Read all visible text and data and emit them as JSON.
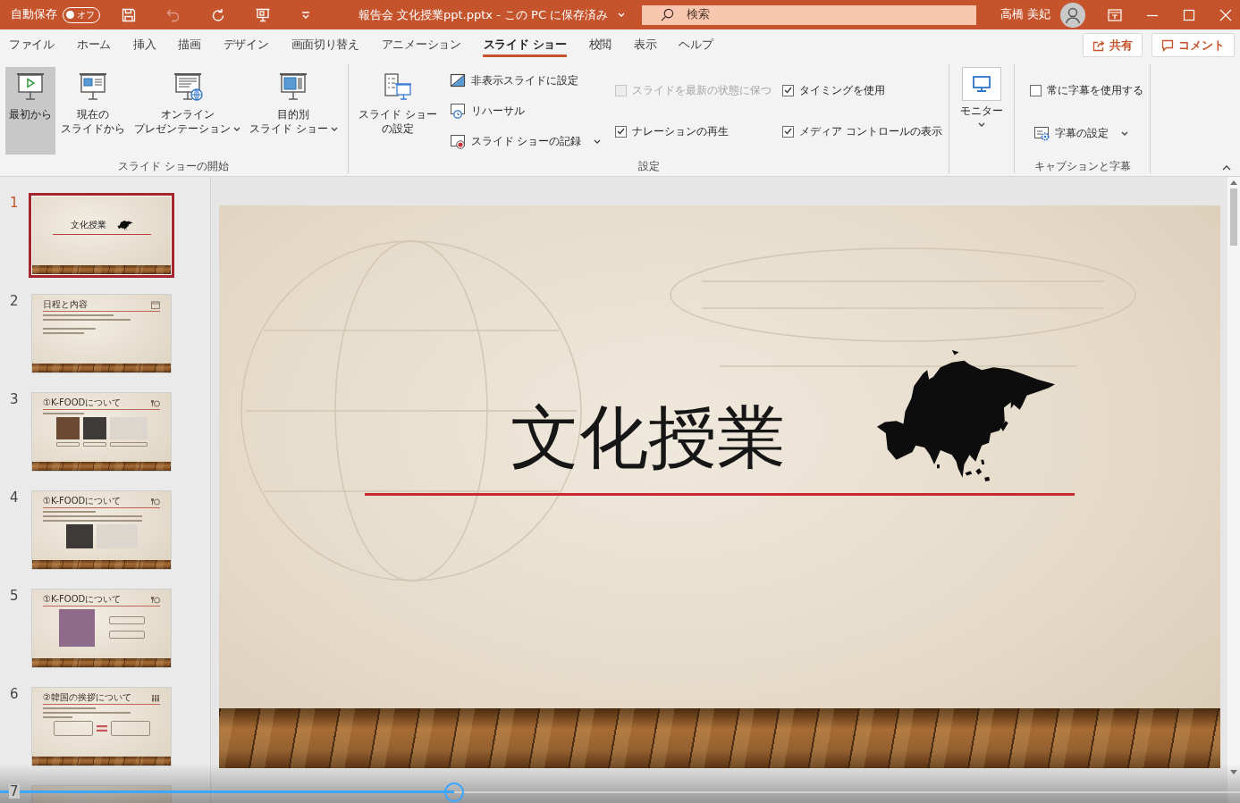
{
  "title_bar": {
    "autosave_label": "自動保存",
    "autosave_toggle": {
      "label": "オフ",
      "on": false
    },
    "quick_access": [
      {
        "kind": "save",
        "disabled": false
      },
      {
        "kind": "undo",
        "disabled": true
      },
      {
        "kind": "redo",
        "disabled": false
      },
      {
        "kind": "present",
        "disabled": false
      },
      {
        "kind": "customize",
        "disabled": false
      }
    ],
    "document_title": "報告会 文化授業ppt.pptx - この PC に保存済み",
    "search": {
      "placeholder": "検索"
    },
    "user_name": "高橋 美妃"
  },
  "ribbon_tabs": [
    {
      "label": "ファイル",
      "selected": false
    },
    {
      "label": "ホーム",
      "selected": false
    },
    {
      "label": "挿入",
      "selected": false
    },
    {
      "label": "描画",
      "selected": false
    },
    {
      "label": "デザイン",
      "selected": false
    },
    {
      "label": "画面切り替え",
      "selected": false
    },
    {
      "label": "アニメーション",
      "selected": false
    },
    {
      "label": "スライド ショー",
      "selected": true
    },
    {
      "label": "校閲",
      "selected": false
    },
    {
      "label": "表示",
      "selected": false
    },
    {
      "label": "ヘルプ",
      "selected": false
    }
  ],
  "share_button": {
    "label": "共有"
  },
  "comment_button": {
    "label": "コメント"
  },
  "ribbon": {
    "groups": [
      {
        "label": "スライド ショーの開始",
        "columns": [
          [
            {
              "kind": "large_button",
              "lines": [
                "最初から"
              ],
              "pressed": true,
              "dropdown": false
            }
          ],
          [
            {
              "kind": "large_button",
              "lines": [
                "現在の",
                "スライドから"
              ],
              "pressed": false,
              "dropdown": false
            }
          ],
          [
            {
              "kind": "large_button",
              "lines": [
                "オンライン",
                "プレゼンテーション"
              ],
              "pressed": false,
              "dropdown": true
            }
          ],
          [
            {
              "kind": "large_button",
              "lines": [
                "目的別",
                "スライド ショー"
              ],
              "pressed": false,
              "dropdown": true
            }
          ]
        ]
      },
      {
        "label": "設定",
        "columns": [
          [
            {
              "kind": "large_button",
              "lines": [
                "スライド ショー",
                "の設定"
              ],
              "pressed": false,
              "dropdown": false
            }
          ],
          [
            {
              "kind": "small_button",
              "lines": [
                "非表示スライドに設定"
              ],
              "pressed": false,
              "dropdown": false
            },
            {
              "kind": "small_button",
              "lines": [
                "リハーサル"
              ],
              "pressed": false,
              "dropdown": false
            },
            {
              "kind": "small_button",
              "lines": [
                "スライド ショーの記録"
              ],
              "pressed": false,
              "dropdown": true
            }
          ],
          [
            {
              "kind": "checkbox",
              "label": "スライドを最新の状態に保つ",
              "checked": false,
              "disabled": true
            },
            {
              "kind": "checkbox",
              "label": "ナレーションの再生",
              "checked": true,
              "disabled": false
            }
          ],
          [
            {
              "kind": "checkbox",
              "label": "タイミングを使用",
              "checked": true,
              "disabled": false
            },
            {
              "kind": "checkbox",
              "label": "メディア コントロールの表示",
              "checked": true,
              "disabled": false
            }
          ]
        ]
      },
      {
        "columns": [
          [
            {
              "kind": "boxed_button",
              "lines": [
                "モニター"
              ],
              "pressed": false,
              "dropdown": true
            }
          ]
        ]
      },
      {
        "label": "キャプションと字幕",
        "columns": [
          [
            {
              "kind": "checkbox",
              "label": "常に字幕を使用する",
              "checked": false,
              "disabled": false
            },
            {
              "kind": "small_button",
              "lines": [
                "字幕の設定"
              ],
              "pressed": false,
              "dropdown": true
            }
          ]
        ]
      }
    ]
  },
  "slides": [
    {
      "number": "1",
      "selected": true,
      "kind": "title",
      "title": "文化授業"
    },
    {
      "number": "2",
      "selected": false,
      "kind": "agenda",
      "title": "日程と内容"
    },
    {
      "number": "3",
      "selected": false,
      "kind": "three_photos",
      "title": "①K-FOODについて"
    },
    {
      "number": "4",
      "selected": false,
      "kind": "two_photos",
      "title": "①K-FOODについて"
    },
    {
      "number": "5",
      "selected": false,
      "kind": "photo_boxes",
      "title": "①K-FOODについて"
    },
    {
      "number": "6",
      "selected": false,
      "kind": "comparison",
      "title": "②韓国の挨拶について"
    },
    {
      "number": "7",
      "selected": false,
      "kind": "cut_off"
    }
  ],
  "main_slide": {
    "title": "文化授業"
  },
  "video_player": {
    "level": 0.366
  }
}
